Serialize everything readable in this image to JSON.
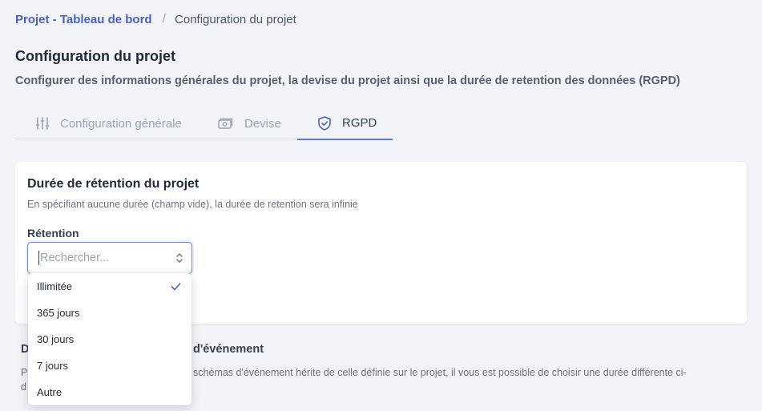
{
  "breadcrumb": {
    "parent": "Projet - Tableau de bord",
    "separator": "/",
    "current": "Configuration du projet"
  },
  "page": {
    "title": "Configuration du projet",
    "description": "Configurer des informations générales du projet, la devise du projet ainsi que la durée de retention des données (RGPD)"
  },
  "tabs": [
    {
      "label": "Configuration générale",
      "icon": "sliders-icon",
      "active": false
    },
    {
      "label": "Devise",
      "icon": "banknote-icon",
      "active": false
    },
    {
      "label": "RGPD",
      "icon": "shield-check-icon",
      "active": true
    }
  ],
  "retention_card": {
    "title": "Durée de rétention du projet",
    "description": "En spécifiant aucune durée (champ vide), la durée de retention sera infinie",
    "field_label": "Rétention",
    "placeholder": "Rechercher...",
    "selected": "Illimitée",
    "options": [
      "Illimitée",
      "365 jours",
      "30 jours",
      "7 jours",
      "Autre"
    ]
  },
  "event_section": {
    "title_start": "D",
    "title_end": "d'événement",
    "desc_start": "P",
    "desc_end": "schémas d'événement hérite de celle définie sur le projet, il vous est possible de choisir une durée différente ci-",
    "desc_line2_start": "d"
  },
  "colors": {
    "accent": "#4a5fc1",
    "tab_active_border": "#5b7cd6",
    "focus_border": "#6b8fe0",
    "background": "#f2f4f8"
  }
}
